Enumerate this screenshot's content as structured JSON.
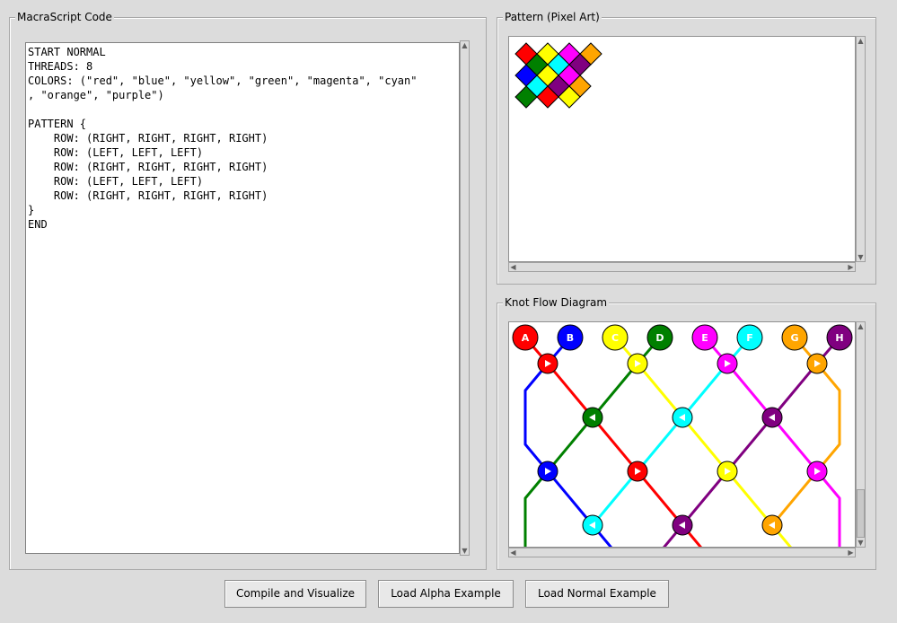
{
  "code_panel": {
    "title": "MacraScript Code",
    "code": "START NORMAL\nTHREADS: 8\nCOLORS: (\"red\", \"blue\", \"yellow\", \"green\", \"magenta\", \"cyan\"\n, \"orange\", \"purple\")\n\nPATTERN {\n    ROW: (RIGHT, RIGHT, RIGHT, RIGHT)\n    ROW: (LEFT, LEFT, LEFT)\n    ROW: (RIGHT, RIGHT, RIGHT, RIGHT)\n    ROW: (LEFT, LEFT, LEFT)\n    ROW: (RIGHT, RIGHT, RIGHT, RIGHT)\n}\nEND"
  },
  "pattern_panel": {
    "title": "Pattern (Pixel Art)",
    "pixel_rows": [
      [
        "red",
        "yellow",
        "magenta",
        "orange"
      ],
      [
        "green",
        "cyan",
        "purple"
      ],
      [
        "blue",
        "yellow",
        "magenta"
      ],
      [
        "cyan",
        "purple",
        "orange"
      ],
      [
        "green",
        "red",
        "yellow"
      ]
    ]
  },
  "diagram_panel": {
    "title": "Knot Flow Diagram",
    "threads": [
      {
        "label": "A",
        "color": "#ff0000"
      },
      {
        "label": "B",
        "color": "#0000ff"
      },
      {
        "label": "C",
        "color": "#ffff00"
      },
      {
        "label": "D",
        "color": "#008000"
      },
      {
        "label": "E",
        "color": "#ff00ff"
      },
      {
        "label": "F",
        "color": "#00ffff"
      },
      {
        "label": "G",
        "color": "#ffa500"
      },
      {
        "label": "H",
        "color": "#800080"
      }
    ],
    "knot_rows": [
      [
        {
          "color": "#ff0000",
          "dir": "right"
        },
        {
          "color": "#ffff00",
          "dir": "right"
        },
        {
          "color": "#ff00ff",
          "dir": "right"
        },
        {
          "color": "#ffa500",
          "dir": "right"
        }
      ],
      [
        {
          "color": "#008000",
          "dir": "left"
        },
        {
          "color": "#00ffff",
          "dir": "left"
        },
        {
          "color": "#800080",
          "dir": "left"
        }
      ],
      [
        {
          "color": "#0000ff",
          "dir": "right"
        },
        {
          "color": "#ff0000",
          "dir": "right"
        },
        {
          "color": "#ffff00",
          "dir": "right"
        },
        {
          "color": "#ff00ff",
          "dir": "right"
        }
      ],
      [
        {
          "color": "#00ffff",
          "dir": "left"
        },
        {
          "color": "#800080",
          "dir": "left"
        },
        {
          "color": "#ffa500",
          "dir": "left"
        }
      ]
    ]
  },
  "buttons": {
    "compile": "Compile and Visualize",
    "load_alpha": "Load Alpha Example",
    "load_normal": "Load Normal Example"
  }
}
